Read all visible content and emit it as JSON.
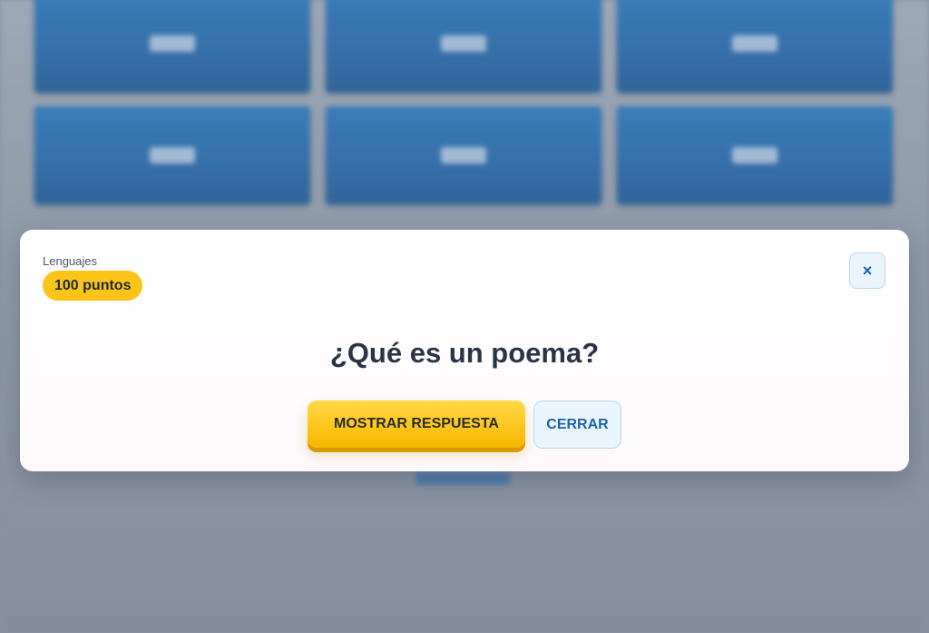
{
  "background": {
    "tiles": [
      "",
      "",
      "",
      "",
      "",
      ""
    ]
  },
  "modal": {
    "category": "Lenguajes",
    "points": "100 puntos",
    "close_icon_glyph": "×",
    "question": "¿Qué es un poema?",
    "show_answer_label": "MOSTRAR RESPUESTA",
    "close_label": "CERRAR"
  },
  "colors": {
    "accent_yellow": "#fcc419",
    "accent_blue": "#1d63a8",
    "tile_blue": "#2a6fb3"
  },
  "icons": {
    "close": "close-icon"
  }
}
